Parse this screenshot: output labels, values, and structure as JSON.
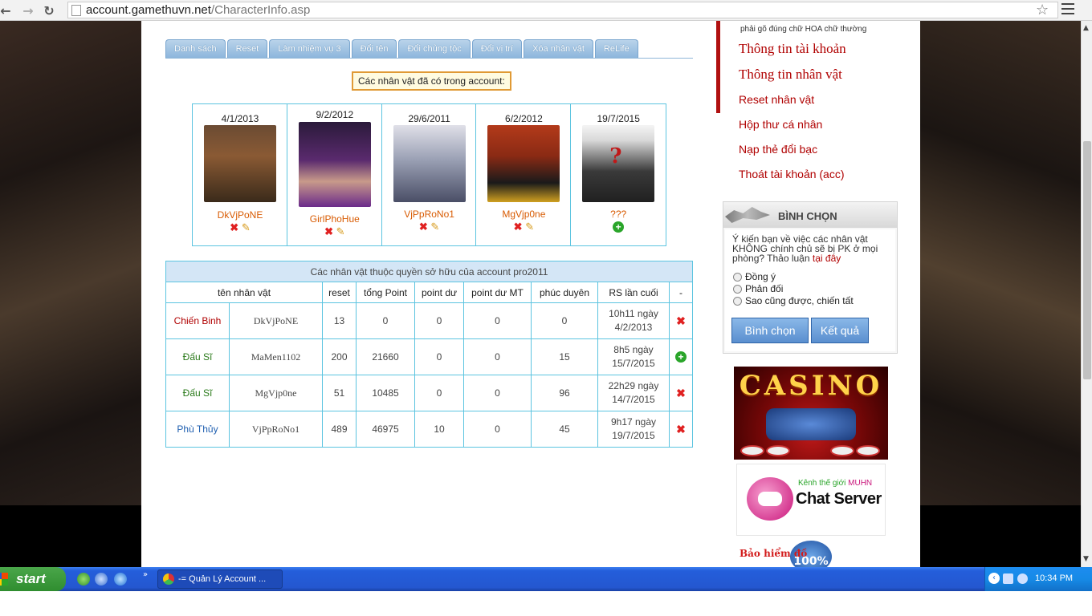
{
  "browser": {
    "url_host": "account.gamethuvn.net",
    "url_path": "/CharacterInfo.asp"
  },
  "tabs": [
    "Danh sách",
    "Reset",
    "Làm nhiệm vụ 3",
    "Đổi tên",
    "Đổi chủng tộc",
    "Đổi vị trí",
    "Xóa nhân vật",
    "ReLife"
  ],
  "characters_heading": "Các nhân vật đã có trong account:",
  "character_cards": [
    {
      "date": "4/1/2013",
      "name": "DkVjPoNE",
      "portrait": "warrior-portrait-icon",
      "color": "#8a5a34"
    },
    {
      "date": "9/2/2012",
      "name": "GirlPhoHue",
      "portrait": "female-mage-portrait-icon",
      "color": "#5a2a6e"
    },
    {
      "date": "29/6/2011",
      "name": "VjPpRoNo1",
      "portrait": "silver-hair-portrait-icon",
      "color": "#9aa0b4"
    },
    {
      "date": "6/2/2012",
      "name": "MgVjp0ne",
      "portrait": "red-hair-portrait-icon",
      "color": "#8a2a14"
    },
    {
      "date": "19/7/2015",
      "name": "???",
      "portrait": "unknown-silhouette-icon",
      "color": "#3a3a3a"
    }
  ],
  "owned_table": {
    "caption": "Các nhân vật thuộc quyền sở hữu của account pro2011",
    "headers": [
      "tên nhân vật",
      "reset",
      "tổng Point",
      "point dư",
      "point dư MT",
      "phúc duyên",
      "RS lần cuối",
      "-"
    ],
    "rows": [
      {
        "class": "Chiến Binh",
        "class_color": "#b00000",
        "name": "DkVjPoNE",
        "reset": "13",
        "total_point": "0",
        "point_du": "0",
        "point_du_mt": "0",
        "phuc_duyen": "0",
        "rs_time": "10h11 ngày",
        "rs_date": "4/2/2013",
        "action": "delete-icon"
      },
      {
        "class": "Đấu Sĩ",
        "class_color": "#2a7a1a",
        "name": "MaMen1102",
        "reset": "200",
        "total_point": "21660",
        "point_du": "0",
        "point_du_mt": "0",
        "phuc_duyen": "15",
        "rs_time": "8h5 ngày",
        "rs_date": "15/7/2015",
        "action": "add-icon"
      },
      {
        "class": "Đấu Sĩ",
        "class_color": "#2a7a1a",
        "name": "MgVjp0ne",
        "reset": "51",
        "total_point": "10485",
        "point_du": "0",
        "point_du_mt": "0",
        "phuc_duyen": "96",
        "rs_time": "22h29 ngày",
        "rs_date": "14/7/2015",
        "action": "delete-icon"
      },
      {
        "class": "Phù Thủy",
        "class_color": "#1f5fb0",
        "name": "VjPpRoNo1",
        "reset": "489",
        "total_point": "46975",
        "point_du": "10",
        "point_du_mt": "0",
        "phuc_duyen": "45",
        "rs_time": "9h17 ngày",
        "rs_date": "19/7/2015",
        "action": "delete-icon"
      }
    ]
  },
  "sidebar": {
    "hint": "phải gõ đúng chữ HOA chữ thường",
    "links": [
      "Thông tin tài khoản",
      "Thông tin nhân vật",
      "Reset nhân vật",
      "Hộp thư cá nhân",
      "Nạp thẻ đổi bạc",
      "Thoát tài khoản (acc)"
    ]
  },
  "poll": {
    "title": "BÌNH CHỌN",
    "question": "Ý kiến bạn về việc các nhân vật KHÔNG chính chủ sẽ bị PK ở mọi phòng? Thảo luận",
    "question_link": "tại đây",
    "options": [
      "Đồng ý",
      "Phản đối",
      "Sao cũng được, chiến tất"
    ],
    "vote_button": "Bình chọn",
    "result_button": "Kết quả"
  },
  "banners": {
    "casino": "CASINO",
    "chat_small": "Kênh thế giới",
    "chat_small_brand": "MUHN",
    "chat_big": "Chat Server",
    "insurance": "Bảo hiểm đồ",
    "insurance_badge": "100%"
  },
  "taskbar": {
    "start": "start",
    "task_title": "-= Quản Lý Account ...",
    "clock": "10:34 PM"
  }
}
